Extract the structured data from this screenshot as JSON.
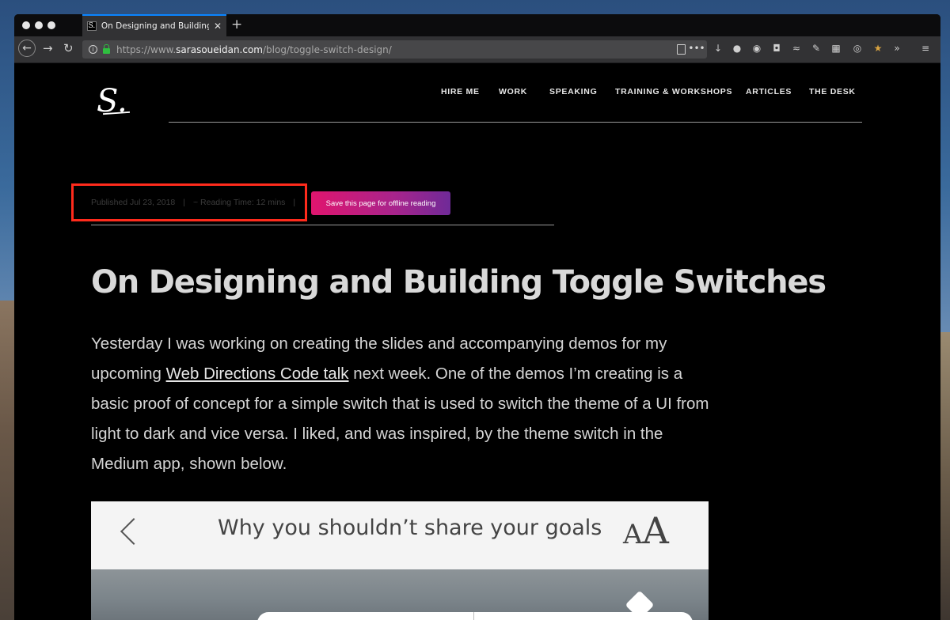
{
  "browser": {
    "tab_title": "On Designing and Building Toggle",
    "tab_favicon": "S.",
    "new_tab_label": "+",
    "url_host": "https://www.sarasoueidan.com",
    "url_host_prefix": "https://www.",
    "url_domain": "sarasoueidan.com",
    "url_path": "/blog/toggle-switch-design/",
    "page_actions_label": "•••",
    "accent": "#0a84ff"
  },
  "site": {
    "logo_text": "S.",
    "nav": [
      "HIRE ME",
      "WORK",
      "SPEAKING",
      "TRAINING & WORKSHOPS",
      "ARTICLES",
      "THE DESK"
    ]
  },
  "meta": {
    "published": "Published Jul 23, 2018",
    "separator": "|",
    "reading_time": "~ Reading Time: 12 mins",
    "save_button": "Save this page for offline reading",
    "highlight_color": "#ff2b1c"
  },
  "article": {
    "title": "On Designing and Building Toggle Switches",
    "p1_before": "Yesterday I was working on creating the slides and accompanying demos for my upcoming ",
    "p1_link": "Web Directions Code talk",
    "p1_after": " next week. One of the demos I’m creating is a basic proof of concept for a simple switch that is used to switch the theme of a UI from light to dark and vice versa. I liked, and was inspired, by the theme switch in the Medium app, shown below."
  },
  "figure": {
    "title": "Why you shouldn’t share your goals",
    "aa_small": "A",
    "aa_big": "A"
  }
}
